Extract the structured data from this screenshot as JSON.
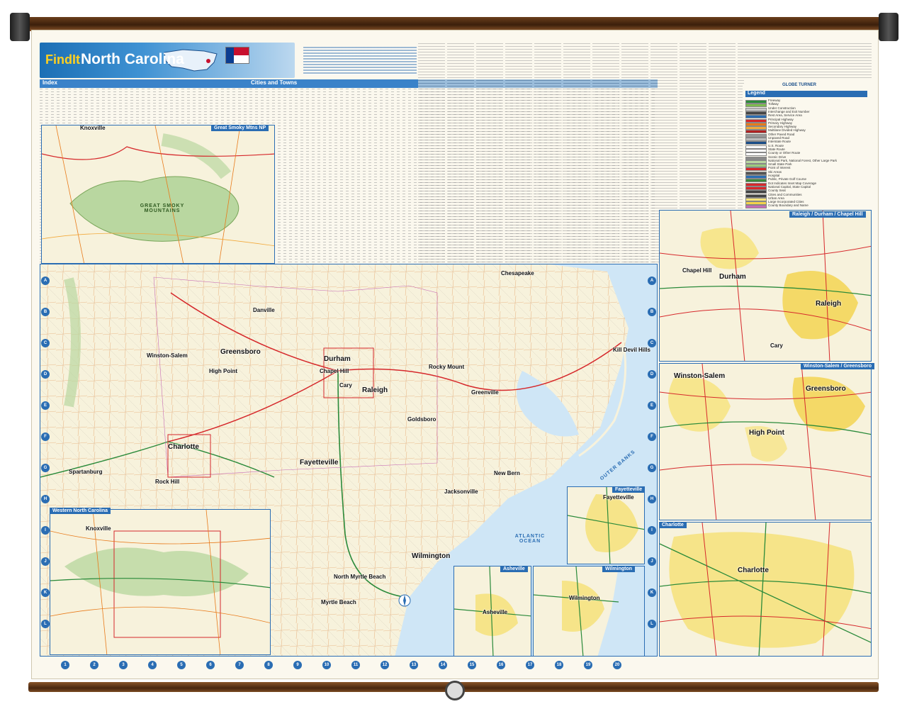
{
  "header": {
    "brand": "FindIt",
    "title": "North Carolina"
  },
  "flag": {
    "colors": [
      "#0b3d91",
      "#c8102e",
      "#ffffff"
    ]
  },
  "index": {
    "label": "Index",
    "cities_label": "Cities and Towns"
  },
  "publisher": "GLOBE TURNER",
  "legend": {
    "title": "Legend",
    "items": [
      {
        "label": "Freeway",
        "color": "#2a8a3a"
      },
      {
        "label": "Tollway",
        "color": "#7dbb4d"
      },
      {
        "label": "Under Construction",
        "color": "#c7c7c7"
      },
      {
        "label": "Interchange and Exit Number",
        "color": "#444444"
      },
      {
        "label": "Rest Area, Service Area",
        "color": "#2a6db3"
      },
      {
        "label": "Principal Highway",
        "color": "#d6282b"
      },
      {
        "label": "Primary Highway",
        "color": "#e87a1a"
      },
      {
        "label": "Secondary Highway",
        "color": "#f2a93b"
      },
      {
        "label": "Multilane Divided Highway",
        "color": "#b22222"
      },
      {
        "label": "Other Paved Road",
        "color": "#999999"
      },
      {
        "label": "Unpaved Road",
        "color": "#bbbbbb"
      },
      {
        "label": "Interstate Route",
        "color": "#1b4f8a"
      },
      {
        "label": "U.S. Route",
        "color": "#ffffff"
      },
      {
        "label": "State Route",
        "color": "#ffffff"
      },
      {
        "label": "County or Other Route",
        "color": "#ffffff"
      },
      {
        "label": "Scenic Drive",
        "color": "#8a8a8a"
      },
      {
        "label": "National Park, National Forest, Other Large Park",
        "color": "#b9d7a0"
      },
      {
        "label": "Small State Park",
        "color": "#9ccb7e"
      },
      {
        "label": "Point of Interest",
        "color": "#d6282b"
      },
      {
        "label": "Ski Areas",
        "color": "#555555"
      },
      {
        "label": "Hospital",
        "color": "#2a6db3"
      },
      {
        "label": "Public, Private Golf Course",
        "color": "#3a8a3a"
      },
      {
        "label": "Dot Indicates Inset Map Coverage",
        "color": "#d6282b"
      },
      {
        "label": "National Capital, State Capital",
        "color": "#d6282b"
      },
      {
        "label": "County Seat",
        "color": "#444444"
      },
      {
        "label": "Cities and Communities",
        "color": "#444444"
      },
      {
        "label": "Urban Area",
        "color": "#f6e27a"
      },
      {
        "label": "Large Incorporated Cities",
        "color": "#f3d24a"
      },
      {
        "label": "County Boundary and Name",
        "color": "#c76bb5"
      }
    ]
  },
  "insets": {
    "smoky": "Great Smoky Mtns NP",
    "western": "Western North Carolina",
    "raleigh": "Raleigh / Durham / Chapel Hill",
    "winston": "Winston-Salem / Greensboro",
    "charlotte": "Charlotte",
    "fayetteville": "Fayetteville",
    "asheville": "Asheville",
    "wilmington": "Wilmington"
  },
  "cities": {
    "knoxville": "Knoxville",
    "charlotte": "Charlotte",
    "greensboro": "Greensboro",
    "winston_salem": "Winston-Salem",
    "durham": "Durham",
    "raleigh": "Raleigh",
    "chapel_hill": "Chapel Hill",
    "cary": "Cary",
    "fayetteville": "Fayetteville",
    "wilmington": "Wilmington",
    "rocky_mount": "Rocky Mount",
    "goldsboro": "Goldsboro",
    "jacksonville": "Jacksonville",
    "greenville": "Greenville",
    "high_point": "High Point",
    "asheville": "Asheville",
    "chesapeake": "Chesapeake",
    "spartanburg": "Spartanburg",
    "rock_hill": "Rock Hill",
    "myrtle_beach": "Myrtle Beach",
    "north_myrtle_beach": "North Myrtle Beach",
    "kill_devil_hills": "Kill Devil Hills",
    "danville": "Danville",
    "new_bern": "New Bern",
    "smoky_mountains": "GREAT SMOKY MOUNTAINS",
    "atlantic_ocean": "ATLANTIC OCEAN",
    "outer_banks": "OUTER BANKS",
    "inset_durham": "Durham",
    "inset_raleigh": "Raleigh",
    "inset_chapel_hill": "Chapel Hill",
    "inset_cary": "Cary",
    "inset_winston": "Winston-Salem",
    "inset_greensboro": "Greensboro",
    "inset_high_point": "High Point",
    "inset_charlotte": "Charlotte",
    "inset_fayetteville": "Fayetteville",
    "inset_asheville": "Asheville",
    "inset_wilmington": "Wilmington",
    "inset_knoxville": "Knoxville",
    "inset_knoxville_w": "Knoxville"
  },
  "grid": {
    "columns": [
      "1",
      "2",
      "3",
      "4",
      "5",
      "6",
      "7",
      "8",
      "9",
      "10",
      "11",
      "12",
      "13",
      "14",
      "15",
      "16",
      "17",
      "18",
      "19",
      "20"
    ],
    "rows": [
      "A",
      "B",
      "C",
      "D",
      "E",
      "F",
      "G",
      "H",
      "I",
      "J",
      "K",
      "L"
    ]
  },
  "colors": {
    "water": "#cfe6f6",
    "land": "#f7f2dc",
    "park": "#b9d7a0",
    "urban": "#f6e27a",
    "frame_blue": "#2a6db3"
  }
}
